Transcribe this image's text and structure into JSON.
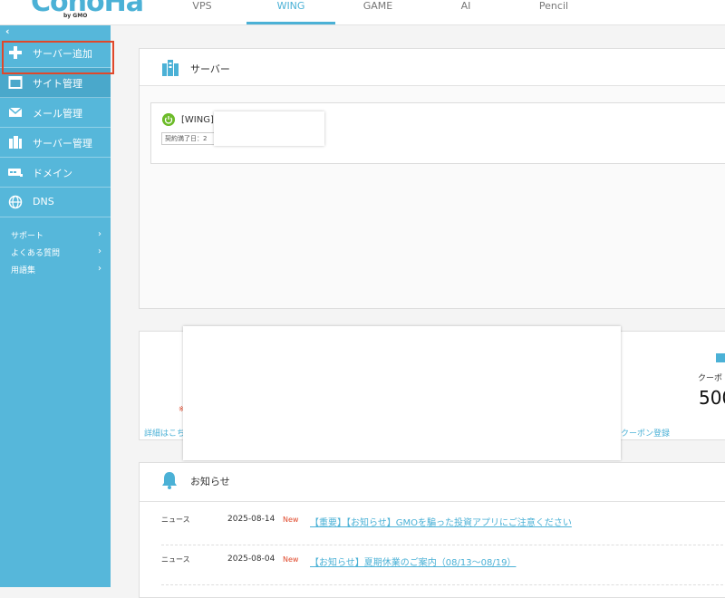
{
  "header": {
    "logo": "ConoHa",
    "logo_sub": "by GMO",
    "tabs": [
      {
        "label": "VPS"
      },
      {
        "label": "WING"
      },
      {
        "label": "GAME"
      },
      {
        "label": "AI"
      },
      {
        "label": "Pencil"
      }
    ],
    "active_tab": "WING"
  },
  "sidebar": {
    "collapse": "‹",
    "items": [
      {
        "label": "サーバー追加",
        "icon": "plus-icon"
      },
      {
        "label": "サイト管理",
        "icon": "window-icon"
      },
      {
        "label": "メール管理",
        "icon": "mail-icon"
      },
      {
        "label": "サーバー管理",
        "icon": "server-icon"
      },
      {
        "label": "ドメイン",
        "icon": "domain-icon"
      },
      {
        "label": "DNS",
        "icon": "globe-icon"
      }
    ],
    "links": [
      {
        "label": "サポート",
        "arrow": "›"
      },
      {
        "label": "よくある質問",
        "arrow": "›"
      },
      {
        "label": "用語集",
        "arrow": "›"
      }
    ]
  },
  "server_panel": {
    "title": "サーバー",
    "server_name": "[WING]",
    "contract_label": "契約満了日：2"
  },
  "coupon": {
    "label": "クーポ",
    "value": "500",
    "detail_link": "詳細はこち",
    "register_link": "クーポン登録",
    "note": "※"
  },
  "news": {
    "title": "お知らせ",
    "items": [
      {
        "category": "ニュース",
        "date": "2025-08-14",
        "badge": "New",
        "text": "【重要】【お知らせ】GMOを騙った投資アプリにご注意ください"
      },
      {
        "category": "ニュース",
        "date": "2025-08-04",
        "badge": "New",
        "text": "【お知らせ】夏期休業のご案内（08/13～08/19）"
      }
    ]
  },
  "colors": {
    "accent": "#4bb1d6",
    "sidebar": "#56b7da",
    "highlight": "#e0482a",
    "power": "#6dbb2a"
  }
}
